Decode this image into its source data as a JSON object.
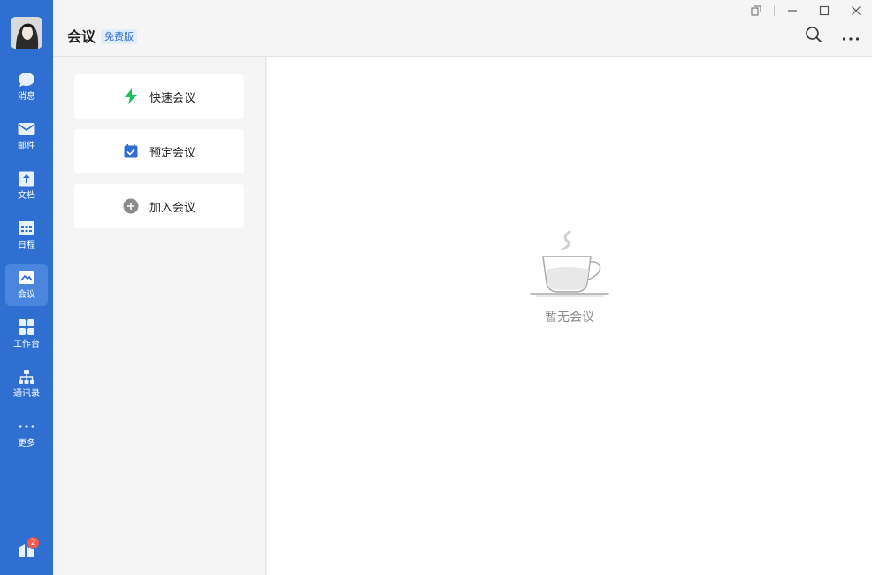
{
  "sidebar": {
    "items": [
      {
        "label": "消息",
        "icon": "chat-bubble-icon"
      },
      {
        "label": "邮件",
        "icon": "mail-icon"
      },
      {
        "label": "文档",
        "icon": "document-icon"
      },
      {
        "label": "日程",
        "icon": "calendar-icon"
      },
      {
        "label": "会议",
        "icon": "meeting-icon",
        "active": true
      },
      {
        "label": "工作台",
        "icon": "grid-icon"
      },
      {
        "label": "通讯录",
        "icon": "org-chart-icon"
      },
      {
        "label": "更多",
        "icon": "more-dots-icon"
      }
    ],
    "badge_count": "2"
  },
  "header": {
    "title": "会议",
    "edition": "免费版"
  },
  "actions": [
    {
      "label": "快速会议",
      "icon": "lightning-icon"
    },
    {
      "label": "预定会议",
      "icon": "calendar-check-icon"
    },
    {
      "label": "加入会议",
      "icon": "plus-circle-icon"
    }
  ],
  "main": {
    "empty_text": "暂无会议"
  },
  "colors": {
    "sidebar": "#2f6fd1",
    "accent_green": "#1fbf5a",
    "accent_blue": "#2f6fd1"
  }
}
